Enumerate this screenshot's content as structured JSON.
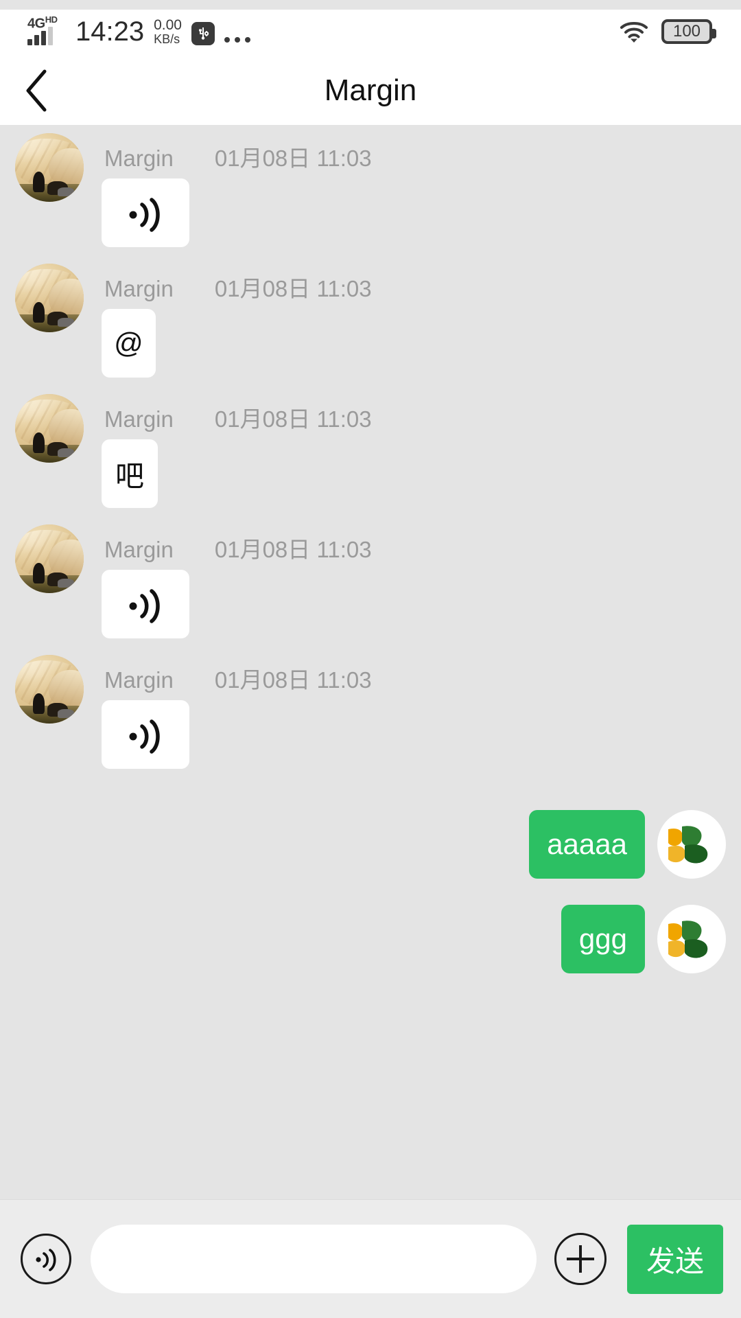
{
  "status_bar": {
    "network_type": "4G",
    "network_suffix": "HD",
    "time": "14:23",
    "net_speed_value": "0.00",
    "net_speed_unit": "KB/s",
    "usb_icon": "usb-debug-icon",
    "overflow_icon": "more-dots-icon",
    "wifi_icon": "wifi-icon",
    "battery_level": "100"
  },
  "header": {
    "back_icon": "back-chevron-icon",
    "title": "Margin"
  },
  "colors": {
    "background": "#e4e4e4",
    "bubble_incoming": "#ffffff",
    "bubble_outgoing": "#2cc063",
    "accent_green": "#2cc063",
    "meta_text": "#9a9a9a"
  },
  "messages": [
    {
      "id": "m1",
      "side": "incoming",
      "sender": "Margin",
      "timestamp": "01月08日 11:03",
      "kind": "voice",
      "content": "",
      "icon": "voice-wave-icon",
      "avatar": "contact-avatar"
    },
    {
      "id": "m2",
      "side": "incoming",
      "sender": "Margin",
      "timestamp": "01月08日 11:03",
      "kind": "emoji",
      "content": "@",
      "icon": "at-sign-icon",
      "avatar": "contact-avatar"
    },
    {
      "id": "m3",
      "side": "incoming",
      "sender": "Margin",
      "timestamp": "01月08日 11:03",
      "kind": "text",
      "content": "吧",
      "icon": "",
      "avatar": "contact-avatar"
    },
    {
      "id": "m4",
      "side": "incoming",
      "sender": "Margin",
      "timestamp": "01月08日 11:03",
      "kind": "voice",
      "content": "",
      "icon": "voice-wave-icon",
      "avatar": "contact-avatar"
    },
    {
      "id": "m5",
      "side": "incoming",
      "sender": "Margin",
      "timestamp": "01月08日 11:03",
      "kind": "voice",
      "content": "",
      "icon": "voice-wave-icon",
      "avatar": "contact-avatar"
    },
    {
      "id": "m6",
      "side": "outgoing",
      "sender": "",
      "timestamp": "",
      "kind": "text",
      "content": "aaaaa",
      "icon": "",
      "avatar": "self-logo-avatar"
    },
    {
      "id": "m7",
      "side": "outgoing",
      "sender": "",
      "timestamp": "",
      "kind": "text",
      "content": "ggg",
      "icon": "",
      "avatar": "self-logo-avatar"
    }
  ],
  "input_bar": {
    "voice_icon": "voice-record-icon",
    "input_value": "",
    "input_placeholder": "",
    "plus_icon": "plus-icon",
    "send_label": "发送"
  }
}
